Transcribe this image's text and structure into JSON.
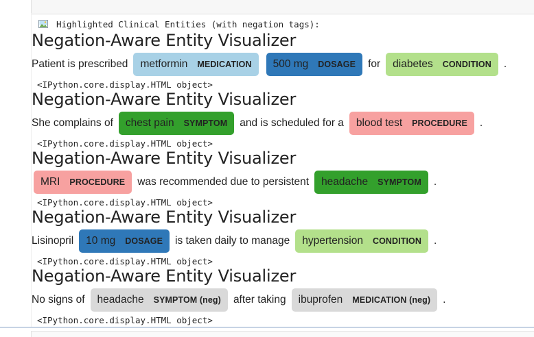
{
  "header": {
    "icon": "image-icon",
    "text": "Highlighted Clinical Entities (with negation tags):"
  },
  "colors": {
    "MEDICATION": "#a8d1e6",
    "DOSAGE": "#2f78b8",
    "CONDITION": "#b3e08b",
    "SYMPTOM": "#33a02c",
    "PROCEDURE": "#f7a1a0",
    "NEGATED": "#d9d9d9"
  },
  "outputs": [
    {
      "title": "Negation-Aware Entity Visualizer",
      "segments": [
        {
          "text": "Patient is prescribed"
        },
        {
          "entity": "metformin",
          "label": "MEDICATION",
          "color_key": "MEDICATION"
        },
        {
          "entity": "500 mg",
          "label": "DOSAGE",
          "color_key": "DOSAGE"
        },
        {
          "text": "for"
        },
        {
          "entity": "diabetes",
          "label": "CONDITION",
          "color_key": "CONDITION"
        },
        {
          "text": "."
        }
      ],
      "repr": "<IPython.core.display.HTML object>"
    },
    {
      "title": "Negation-Aware Entity Visualizer",
      "segments": [
        {
          "text": "She complains of"
        },
        {
          "entity": "chest pain",
          "label": "SYMPTOM",
          "color_key": "SYMPTOM"
        },
        {
          "text": "and is scheduled for a"
        },
        {
          "entity": "blood test",
          "label": "PROCEDURE",
          "color_key": "PROCEDURE"
        },
        {
          "text": "."
        }
      ],
      "repr": "<IPython.core.display.HTML object>"
    },
    {
      "title": "Negation-Aware Entity Visualizer",
      "segments": [
        {
          "entity": "MRI",
          "label": "PROCEDURE",
          "color_key": "PROCEDURE"
        },
        {
          "text": "was recommended due to persistent"
        },
        {
          "entity": "headache",
          "label": "SYMPTOM",
          "color_key": "SYMPTOM"
        },
        {
          "text": "."
        }
      ],
      "repr": "<IPython.core.display.HTML object>"
    },
    {
      "title": "Negation-Aware Entity Visualizer",
      "segments": [
        {
          "text": "Lisinopril"
        },
        {
          "entity": "10 mg",
          "label": "DOSAGE",
          "color_key": "DOSAGE"
        },
        {
          "text": "is taken daily to manage"
        },
        {
          "entity": "hypertension",
          "label": "CONDITION",
          "color_key": "CONDITION"
        },
        {
          "text": "."
        }
      ],
      "repr": "<IPython.core.display.HTML object>"
    },
    {
      "title": "Negation-Aware Entity Visualizer",
      "segments": [
        {
          "text": "No signs of"
        },
        {
          "entity": "headache",
          "label": "SYMPTOM (neg)",
          "color_key": "NEGATED"
        },
        {
          "text": "after taking"
        },
        {
          "entity": "ibuprofen",
          "label": "MEDICATION (neg)",
          "color_key": "NEGATED"
        },
        {
          "text": "."
        }
      ],
      "repr": "<IPython.core.display.HTML object>"
    }
  ]
}
